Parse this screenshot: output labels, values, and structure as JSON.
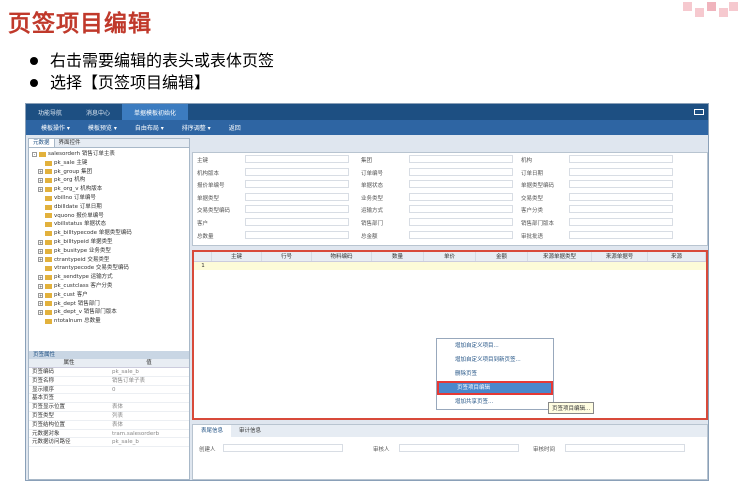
{
  "slide": {
    "title": "页签项目编辑",
    "bullets": [
      "右击需要编辑的表头或表体页签",
      "选择【页签项目编辑】"
    ]
  },
  "app": {
    "top_tabs": [
      "功能导航",
      "消息中心",
      "单据模板初始化"
    ],
    "menu": [
      "模板操作 ▾",
      "模板预览 ▾",
      "自由布局 ▾",
      "排序调整 ▾",
      "返回"
    ],
    "left_tabs": [
      "元数据",
      "界面控件"
    ],
    "tree": [
      {
        "expander": "-",
        "label": "salesorderh 销售订单主表"
      },
      {
        "expander": "",
        "label": "pk_sale 主键"
      },
      {
        "expander": "+",
        "label": "pk_group 集团"
      },
      {
        "expander": "+",
        "label": "pk_org 机构"
      },
      {
        "expander": "+",
        "label": "pk_org_v 机构版本"
      },
      {
        "expander": "",
        "label": "vbillno 订单编号"
      },
      {
        "expander": "",
        "label": "dbilldate 订单日期"
      },
      {
        "expander": "",
        "label": "vquono 报价单编号"
      },
      {
        "expander": "",
        "label": "vbillstatus 单据状态"
      },
      {
        "expander": "",
        "label": "pk_billtypecode 单据类型编码"
      },
      {
        "expander": "+",
        "label": "pk_billtypeid 单据类型"
      },
      {
        "expander": "+",
        "label": "pk_busitype 业务类型"
      },
      {
        "expander": "+",
        "label": "ctrantypeid 交易类型"
      },
      {
        "expander": "",
        "label": "vtrantypecode 交易类型编码"
      },
      {
        "expander": "+",
        "label": "pk_sendtype 运输方式"
      },
      {
        "expander": "+",
        "label": "pk_custclass 客户分类"
      },
      {
        "expander": "+",
        "label": "pk_cust 客户"
      },
      {
        "expander": "+",
        "label": "pk_dept 销售部门"
      },
      {
        "expander": "+",
        "label": "pk_dept_v 销售部门版本"
      },
      {
        "expander": "",
        "label": "ntotalnum 总数量"
      }
    ],
    "props_header": "页签属性",
    "props_cols": [
      "属性",
      "值"
    ],
    "props": [
      [
        "页签编码",
        "pk_sale_b"
      ],
      [
        "页签名称",
        "销售订单子表"
      ],
      [
        "显示顺序",
        "0"
      ],
      [
        "基本页签",
        ""
      ],
      [
        "页签显示位置",
        "表体"
      ],
      [
        "页签类型",
        "列表"
      ],
      [
        "页签结构位置",
        "表体"
      ],
      [
        "元数据对象",
        "tram.salesorderb"
      ],
      [
        "元数据访问路径",
        "pk_sale_b"
      ]
    ],
    "form_fields": [
      [
        "主键",
        "集团",
        "机构"
      ],
      [
        "机构版本",
        "订单编号",
        "订单日期"
      ],
      [
        "报价单编号",
        "单据状态",
        "单据类型编码"
      ],
      [
        "单据类型",
        "业务类型",
        "交易类型"
      ],
      [
        "交易类型编码",
        "运输方式",
        "客户分类"
      ],
      [
        "客户",
        "销售部门",
        "销售部门版本"
      ],
      [
        "总数量",
        "总金额",
        "审批批语"
      ]
    ],
    "grid_cols": [
      "",
      "主键",
      "行号",
      "物料编码",
      "数量",
      "单价",
      "金额",
      "来源单据类型",
      "来源单据号",
      "来源"
    ],
    "grid_row": "1",
    "context_menu": [
      "增加自定义项目...",
      "增加自定义项目到新页签...",
      "删除页签",
      "页签项目编辑",
      "增加共享页签..."
    ],
    "tooltip": "页签项目编辑...",
    "bottom_tabs": [
      "表尾信息",
      "审计信息"
    ],
    "bottom_fields": [
      "创建人",
      "审核人",
      "审核时间"
    ]
  }
}
